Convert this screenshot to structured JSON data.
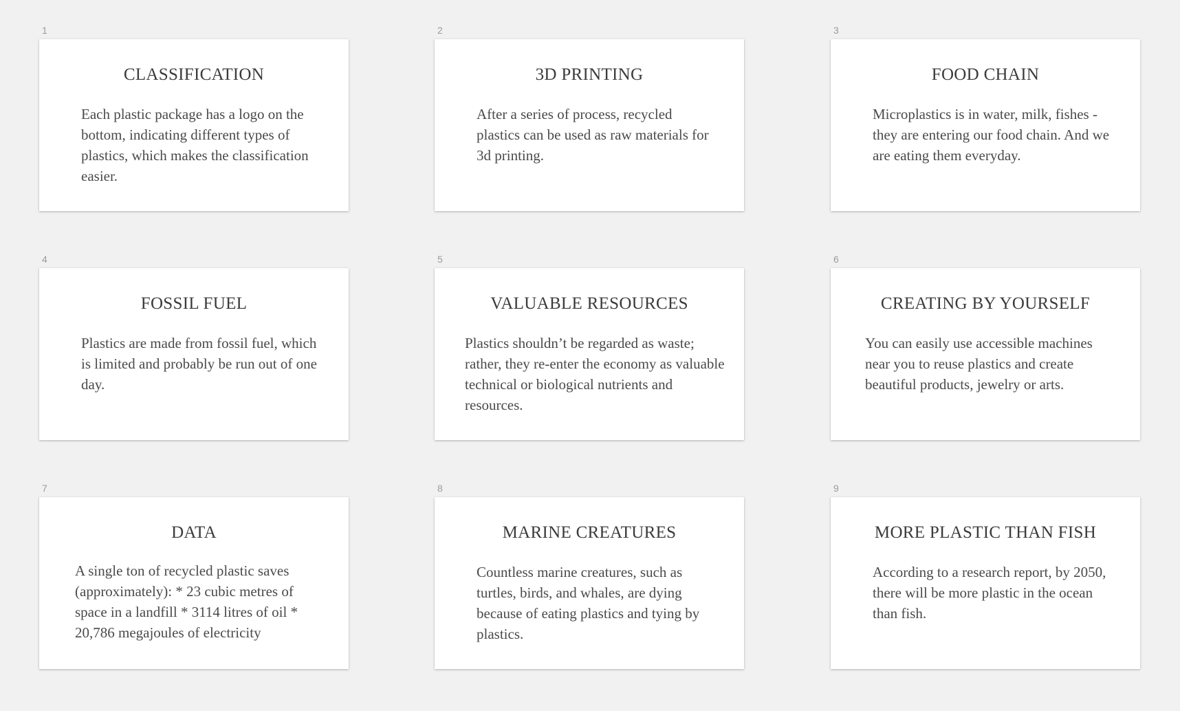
{
  "cards": [
    {
      "number": "1",
      "title": "CLASSIFICATION",
      "body": "Each plastic package has a logo on the bottom, indicating different types of plastics, which makes the classification easier."
    },
    {
      "number": "2",
      "title": "3D PRINTING",
      "body": "After a series of process, recycled plastics can be used as raw materials for 3d printing."
    },
    {
      "number": "3",
      "title": "FOOD CHAIN",
      "body": "Microplastics is in water, milk, fishes - they are entering our food chain. And we are eating them everyday."
    },
    {
      "number": "4",
      "title": "FOSSIL FUEL",
      "body": "Plastics are made from fossil fuel, which is limited and probably be run out of one day."
    },
    {
      "number": "5",
      "title": "VALUABLE RESOURCES",
      "body": "Plastics shouldn’t be regarded as waste; rather, they re-enter the economy as valuable technical or biological nutrients and resources."
    },
    {
      "number": "6",
      "title": "CREATING BY YOURSELF",
      "body": "You can easily use accessible machines near you to reuse plastics and create beautiful products, jewelry or arts."
    },
    {
      "number": "7",
      "title": "DATA",
      "body": "A single ton of recycled plastic saves (approximately): * 23 cubic metres of space in a landfill * 3114 litres of oil * 20,786 megajoules of electricity"
    },
    {
      "number": "8",
      "title": "MARINE CREATURES",
      "body": "Countless marine creatures, such as turtles, birds, and whales, are dying because of eating plastics and tying by plastics."
    },
    {
      "number": "9",
      "title": "MORE PLASTIC THAN FISH",
      "body": "According to a research report, by 2050, there will be more plastic in the ocean than fish."
    }
  ]
}
